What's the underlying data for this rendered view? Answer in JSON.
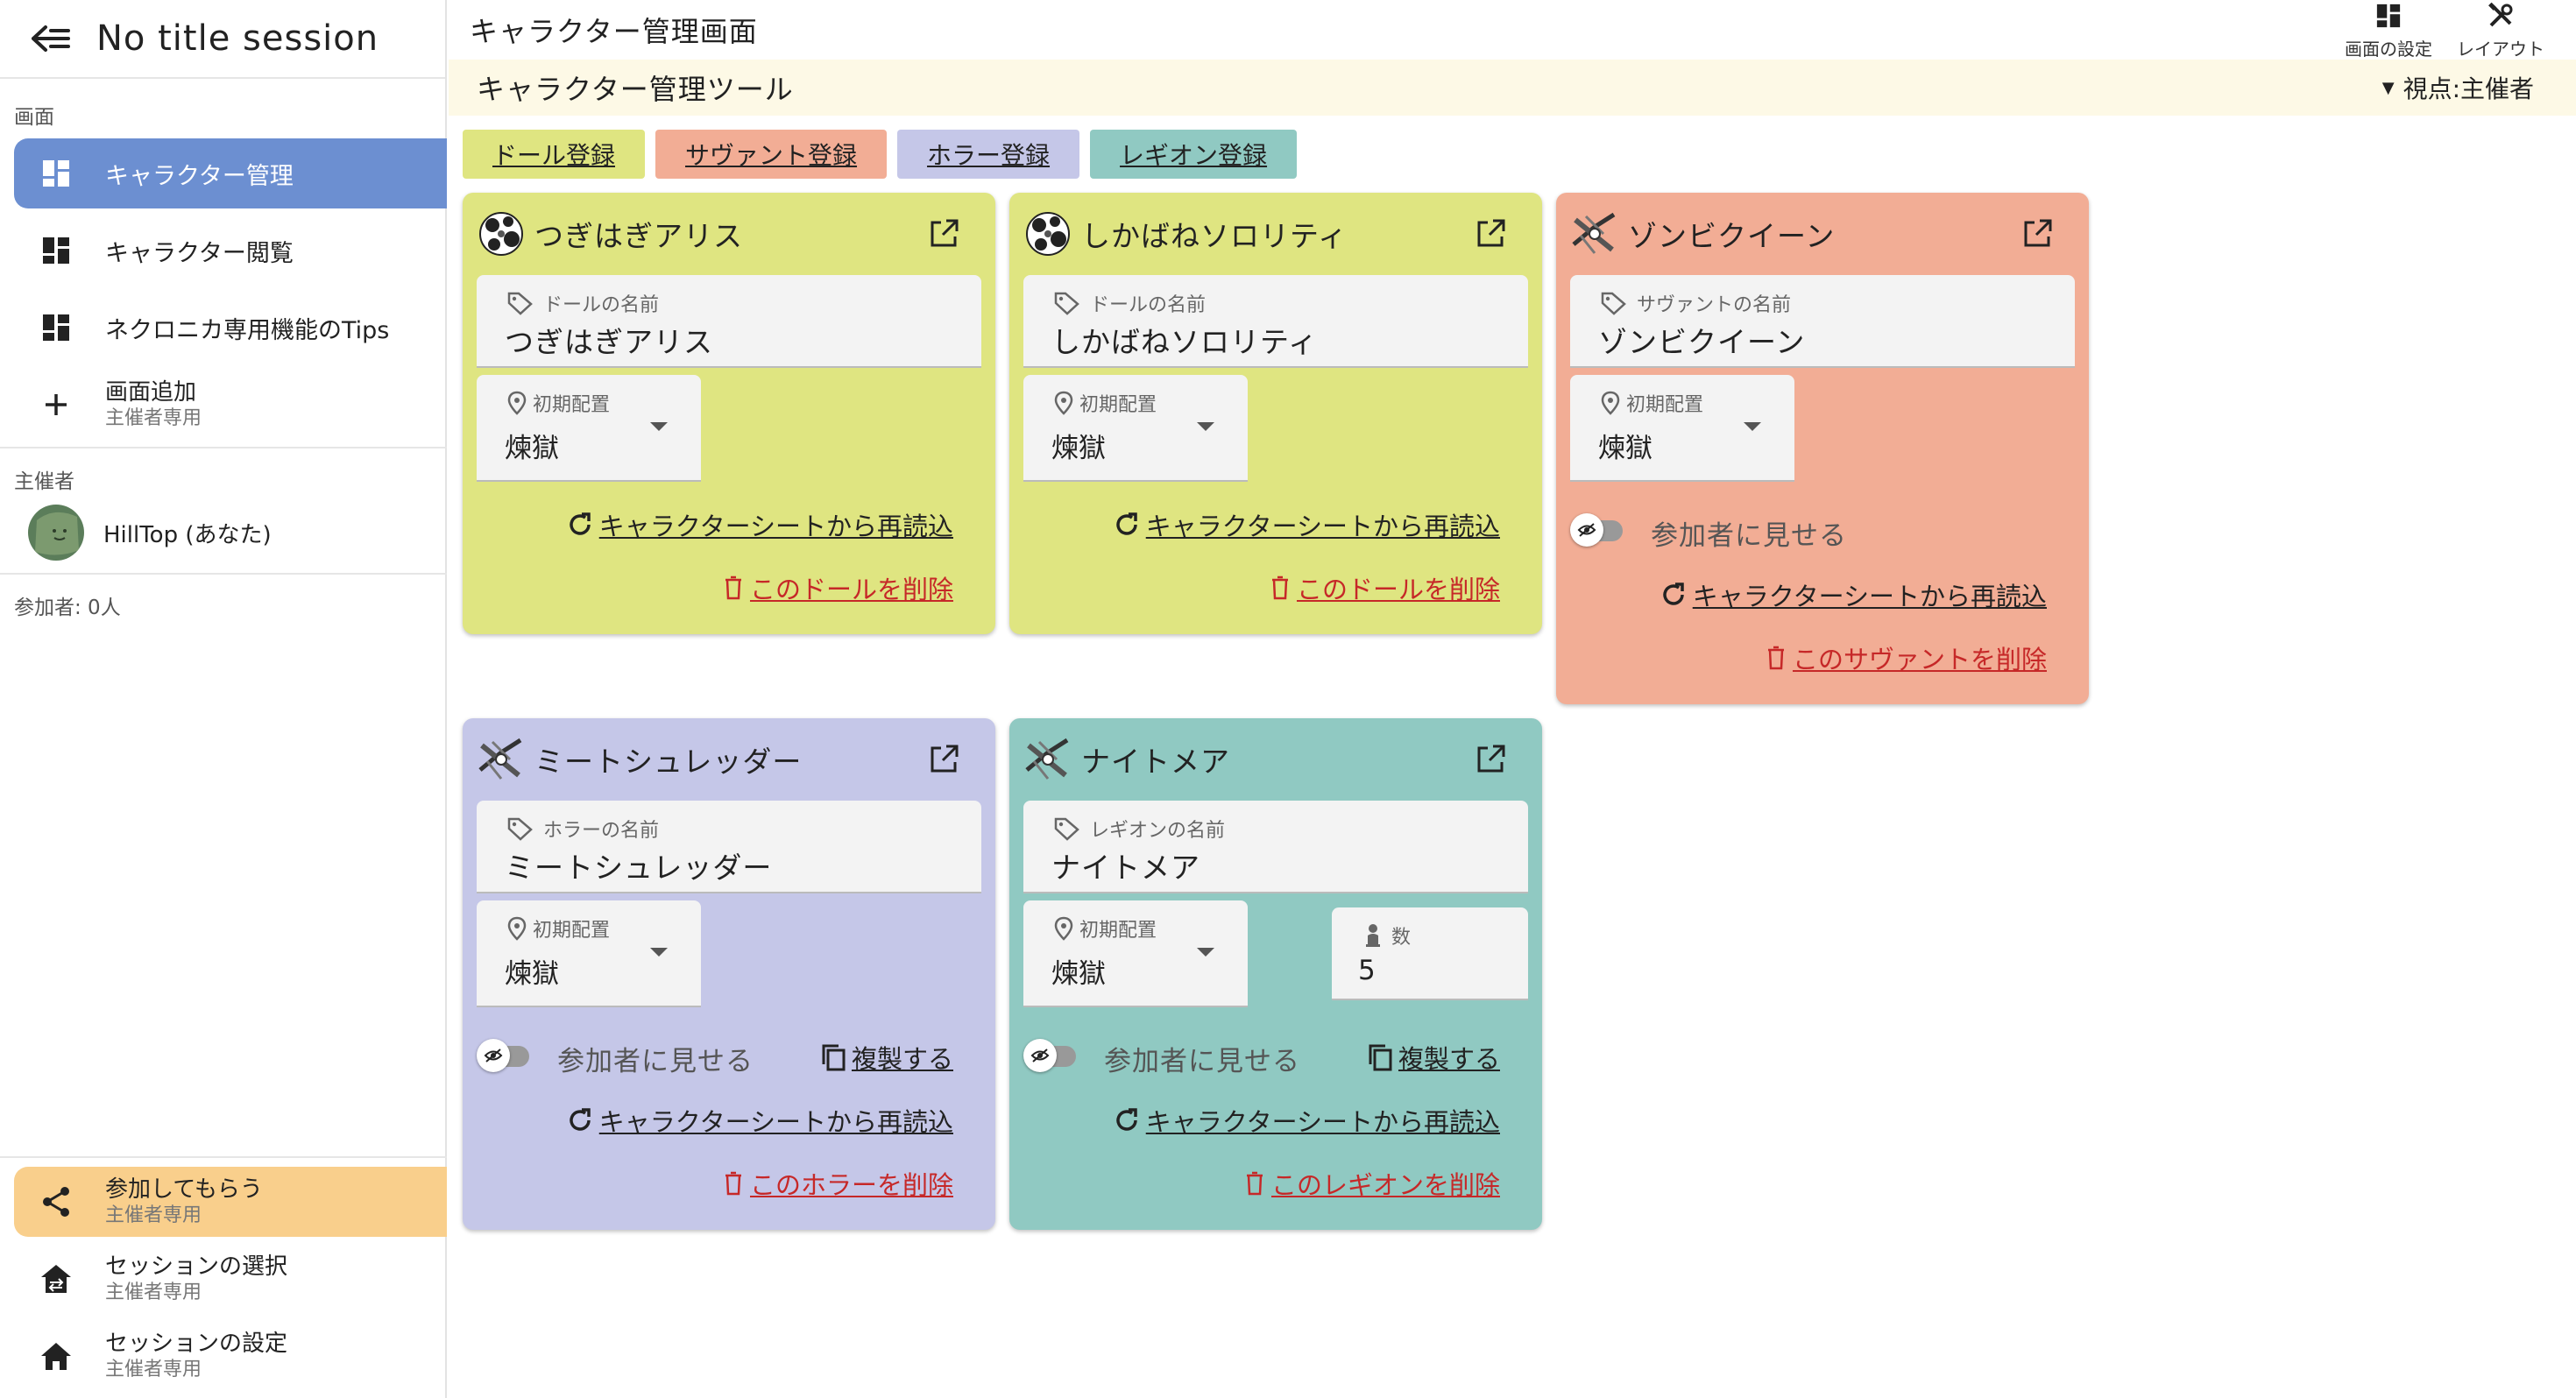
{
  "sidebar": {
    "session_title": "No title session",
    "screens_label": "画面",
    "items": [
      {
        "label": "キャラクター管理"
      },
      {
        "label": "キャラクター閲覧"
      },
      {
        "label": "ネクロニカ専用機能のTips"
      }
    ],
    "add_screen": {
      "label": "画面追加",
      "sub": "主催者専用"
    },
    "organizer_label": "主催者",
    "user_name": "HillTop (あなた)",
    "participants": "参加者: 0人",
    "bottom": [
      {
        "label": "参加してもらう",
        "sub": "主催者専用"
      },
      {
        "label": "セッションの選択",
        "sub": "主催者専用"
      },
      {
        "label": "セッションの設定",
        "sub": "主催者専用"
      }
    ]
  },
  "header": {
    "page_title": "キャラクター管理画面",
    "screen_settings": "画面の設定",
    "layout": "レイアウト"
  },
  "banner": {
    "tool_title": "キャラクター管理ツール",
    "viewpoint_caret": "▼",
    "viewpoint": "視点:主催者"
  },
  "register_buttons": [
    {
      "label": "ドール登録",
      "color": "#dfe581"
    },
    {
      "label": "サヴァント登録",
      "color": "#f2ad95"
    },
    {
      "label": "ホラー登録",
      "color": "#c5c7e8"
    },
    {
      "label": "レギオン登録",
      "color": "#90c9c2"
    }
  ],
  "labels": {
    "placement": "初期配置",
    "show_to_participants": "参加者に見せる",
    "duplicate": "複製する",
    "reload": "キャラクターシートから再読込",
    "count": "数"
  },
  "cards": [
    {
      "type": "doll",
      "name": "つぎはぎアリス",
      "name_label": "ドールの名前",
      "placement": "煉獄",
      "delete": "このドールを削除",
      "color": "#dfe581",
      "icon": "doll-avatar-icon"
    },
    {
      "type": "doll",
      "name": "しかばねソロリティ",
      "name_label": "ドールの名前",
      "placement": "煉獄",
      "delete": "このドールを削除",
      "color": "#dfe581",
      "icon": "doll-avatar-icon"
    },
    {
      "type": "savant",
      "name": "ゾンビクイーン",
      "name_label": "サヴァントの名前",
      "placement": "煉獄",
      "delete": "このサヴァントを削除",
      "color": "#f2ad95",
      "icon": "enemy-avatar-icon"
    },
    {
      "type": "horror",
      "name": "ミートシュレッダー",
      "name_label": "ホラーの名前",
      "placement": "煉獄",
      "delete": "このホラーを削除",
      "color": "#c5c7e8",
      "icon": "enemy-avatar-icon"
    },
    {
      "type": "legion",
      "name": "ナイトメア",
      "name_label": "レギオンの名前",
      "placement": "煉獄",
      "count": "5",
      "delete": "このレギオンを削除",
      "color": "#90c9c2",
      "icon": "enemy-avatar-icon"
    }
  ]
}
